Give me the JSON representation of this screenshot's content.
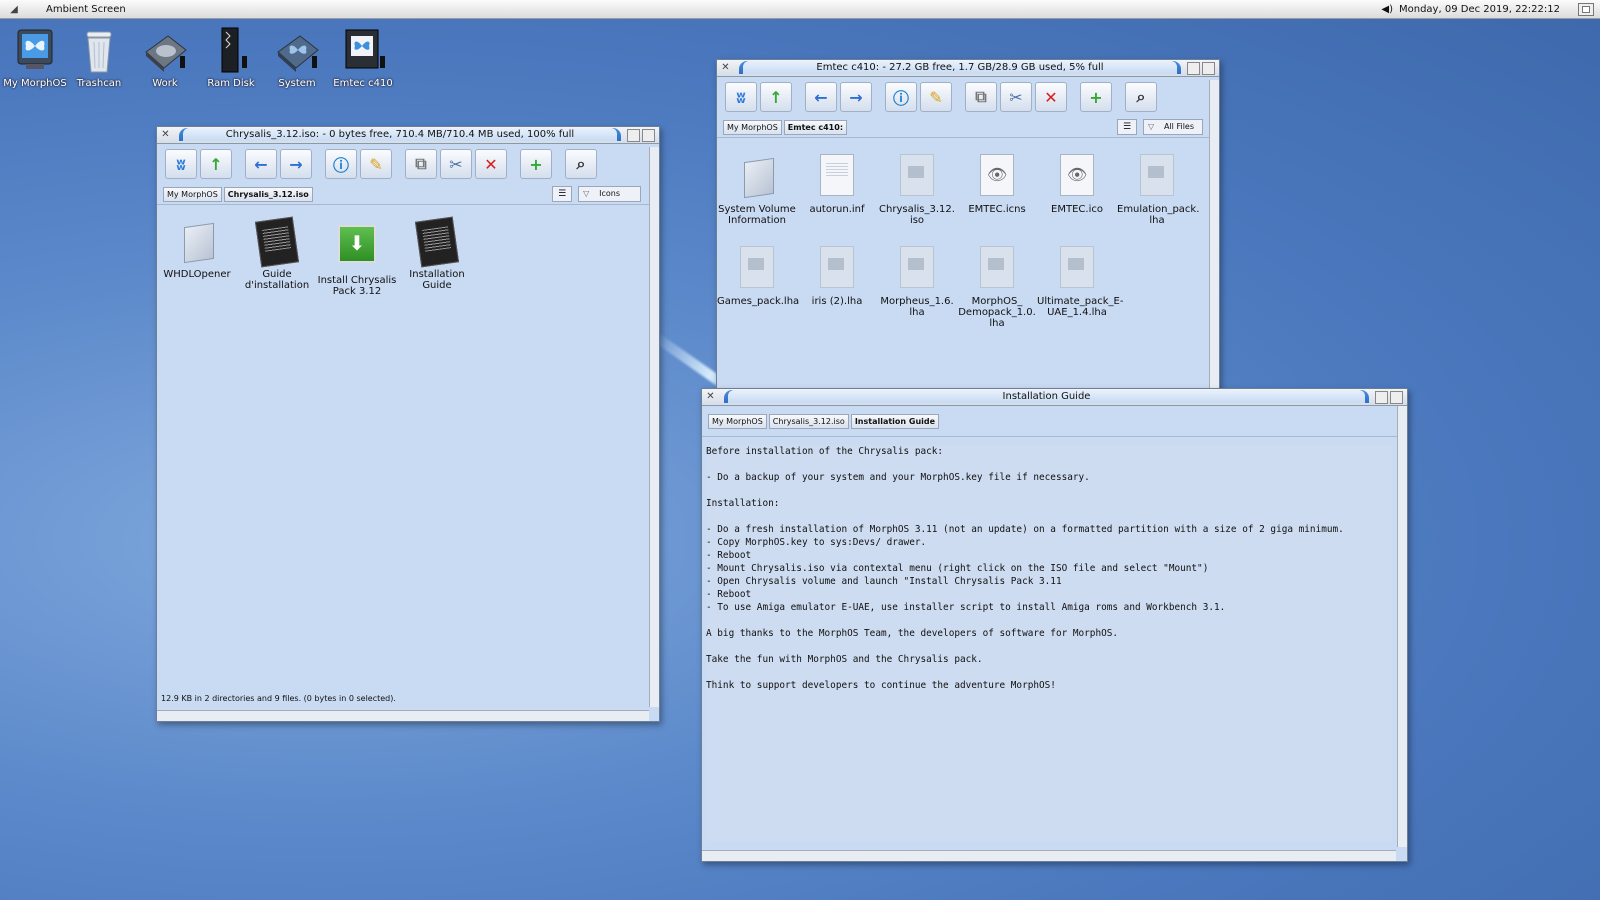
{
  "topbar": {
    "screen_title": "Ambient Screen",
    "clock": "Monday, 09 Dec 2019, 22:22:12"
  },
  "desktop": {
    "icons": [
      {
        "label": "My MorphOS",
        "icon": "monitor-butterfly-icon"
      },
      {
        "label": "Trashcan",
        "icon": "trashcan-icon"
      },
      {
        "label": "Work",
        "icon": "hard-disk-icon"
      },
      {
        "label": "Ram Disk",
        "icon": "ram-disk-icon"
      },
      {
        "label": "System",
        "icon": "system-disk-icon"
      },
      {
        "label": "Emtec c410",
        "icon": "usb-drive-icon"
      }
    ]
  },
  "win_chrysalis": {
    "title": "Chrysalis_3.12.iso: - 0 bytes free, 710.4 MB/710.4 MB used, 100% full",
    "breadcrumbs": [
      "My MorphOS",
      "Chrysalis_3.12.iso"
    ],
    "view_mode": "Icons",
    "files": [
      {
        "label1": "WHDLOpener",
        "label2": "",
        "icon": "folder-icon"
      },
      {
        "label1": "Guide",
        "label2": "d'installation",
        "icon": "guide-icon"
      },
      {
        "label1": "Install Chrysalis",
        "label2": "Pack 3.12",
        "icon": "installer-icon"
      },
      {
        "label1": "Installation",
        "label2": "Guide",
        "icon": "guide-icon"
      }
    ],
    "status": "12.9 KB in 2 directories and 9 files. (0 bytes in 0 selected)."
  },
  "win_emtec": {
    "title": "Emtec c410: - 27.2 GB free, 1.7 GB/28.9 GB used, 5% full",
    "breadcrumbs": [
      "My MorphOS",
      "Emtec c410:"
    ],
    "view_mode": "All Files",
    "files": [
      {
        "label1": "System Volume",
        "label2": "Information",
        "label3": "",
        "icon": "folder-icon"
      },
      {
        "label1": "autorun.inf",
        "label2": "",
        "label3": "",
        "icon": "text-file-icon"
      },
      {
        "label1": "Chrysalis_3.12.",
        "label2": "iso",
        "label3": "",
        "icon": "iso-file-icon"
      },
      {
        "label1": "EMTEC.icns",
        "label2": "",
        "label3": "",
        "icon": "eye-file-icon"
      },
      {
        "label1": "EMTEC.ico",
        "label2": "",
        "label3": "",
        "icon": "eye-file-icon"
      },
      {
        "label1": "Emulation_pack.",
        "label2": "lha",
        "label3": "",
        "icon": "lha-file-icon"
      },
      {
        "label1": "Games_pack.lha",
        "label2": "",
        "label3": "",
        "icon": "lha-file-icon"
      },
      {
        "label1": "iris (2).lha",
        "label2": "",
        "label3": "",
        "icon": "lha-file-icon"
      },
      {
        "label1": "Morpheus_1.6.",
        "label2": "lha",
        "label3": "",
        "icon": "lha-file-icon"
      },
      {
        "label1": "MorphOS_",
        "label2": "Demopack_1.0.",
        "label3": "lha",
        "icon": "lha-file-icon"
      },
      {
        "label1": "Ultimate_pack_E-",
        "label2": "UAE_1.4.lha",
        "label3": "",
        "icon": "lha-file-icon"
      }
    ]
  },
  "win_guide": {
    "title": "Installation Guide",
    "breadcrumbs": [
      "My MorphOS",
      "Chrysalis_3.12.iso",
      "Installation Guide"
    ],
    "lines": [
      "Before installation of the Chrysalis pack:",
      "",
      "- Do a backup of your system and your MorphOS.key file if necessary.",
      "",
      "Installation:",
      "",
      "- Do a fresh installation of MorphOS 3.11 (not an update) on a formatted partition with a size of 2 giga minimum.",
      "- Copy MorphOS.key to sys:Devs/ drawer.",
      "- Reboot",
      "- Mount Chrysalis.iso via contextal menu (right click on the ISO file and select \"Mount\")",
      "- Open Chrysalis volume and launch \"Install Chrysalis Pack 3.11",
      "- Reboot",
      "- To use Amiga emulator E-UAE, use installer script to install Amiga roms and Workbench 3.1.",
      "",
      "A big thanks to the MorphOS Team, the developers of software for MorphOS.",
      "",
      "Take the fun with MorphOS and the Chrysalis pack.",
      "",
      "Think to support developers to continue the adventure MorphOS!"
    ]
  }
}
